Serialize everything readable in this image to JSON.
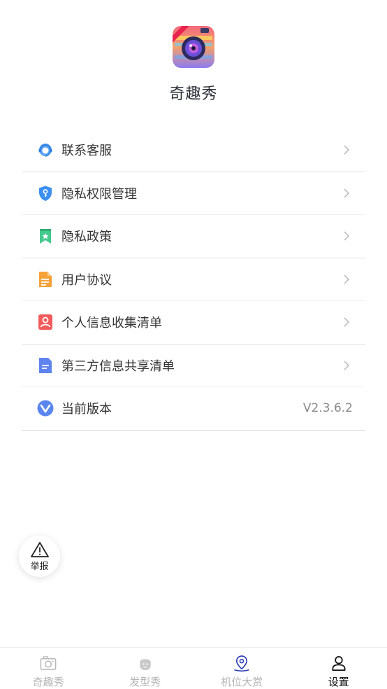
{
  "header": {
    "app_name": "奇趣秀"
  },
  "menu": [
    {
      "id": "contact-service",
      "label": "联系客服"
    },
    {
      "id": "privacy-permissions",
      "label": "隐私权限管理"
    },
    {
      "id": "privacy-policy",
      "label": "隐私政策"
    },
    {
      "id": "user-agreement",
      "label": "用户协议"
    },
    {
      "id": "personal-info-list",
      "label": "个人信息收集清单"
    },
    {
      "id": "third-party-list",
      "label": "第三方信息共享清单"
    },
    {
      "id": "current-version",
      "label": "当前版本",
      "value": "V2.3.6.2"
    }
  ],
  "report": {
    "label": "举报"
  },
  "bottom_nav": [
    {
      "label": "奇趣秀"
    },
    {
      "label": "发型秀"
    },
    {
      "label": "机位大赏"
    },
    {
      "label": "设置",
      "active": true
    }
  ],
  "colors": {
    "accent_blue": "#4b8ef2",
    "text": "#333333",
    "muted": "#b5b5b5"
  }
}
